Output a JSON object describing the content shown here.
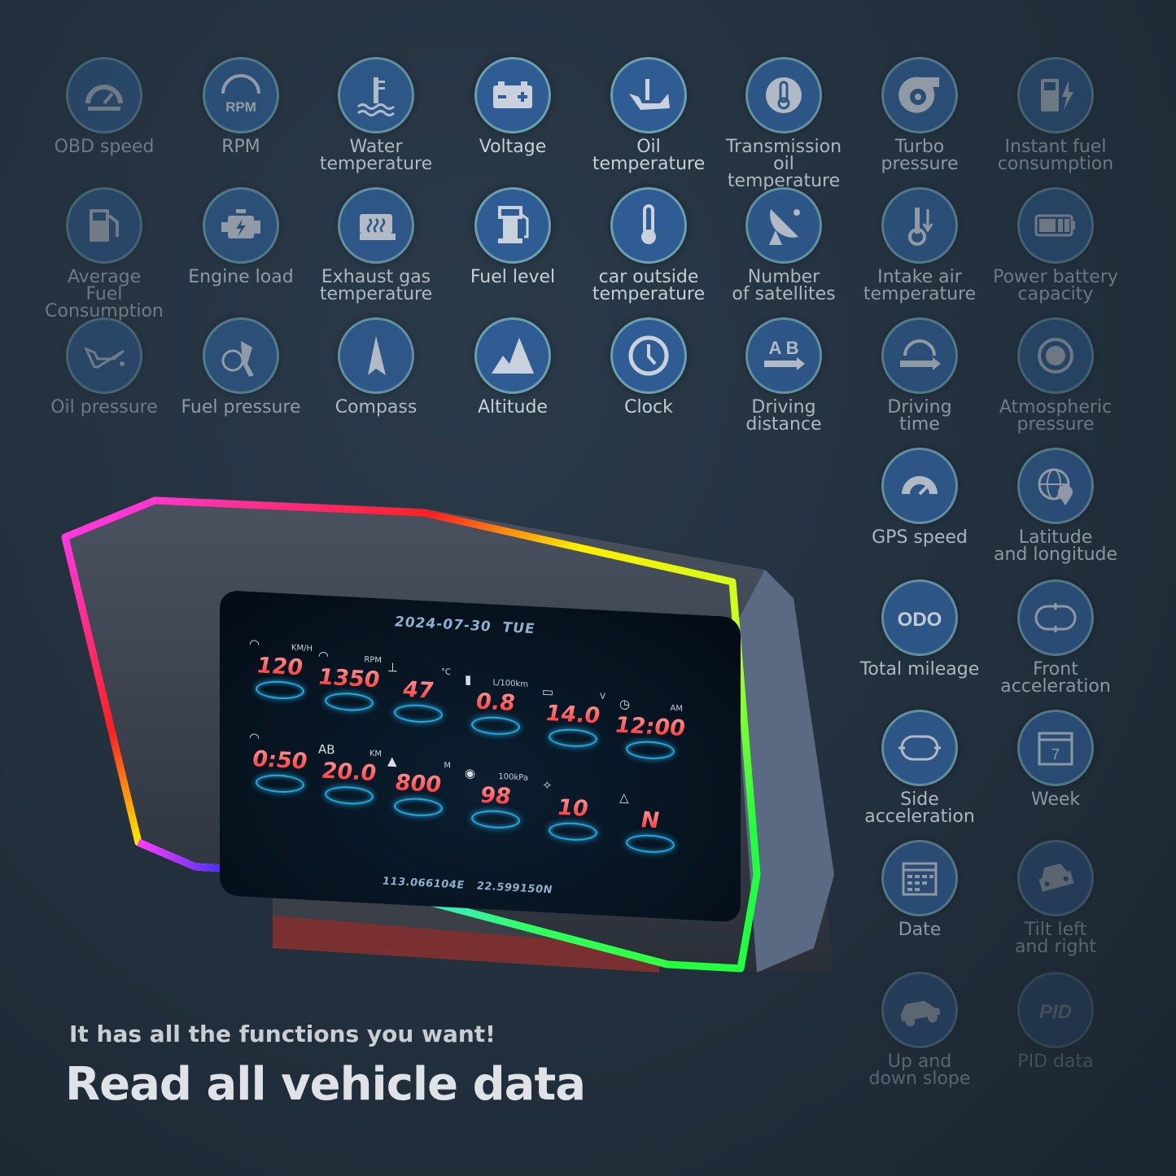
{
  "features": [
    {
      "label": "OBD speed",
      "icon": "speedometer-wrench-icon"
    },
    {
      "label": "RPM",
      "icon": "rpm-gauge-icon"
    },
    {
      "label": "Water\ntemperature",
      "icon": "coolant-temperature-icon"
    },
    {
      "label": "Voltage",
      "icon": "battery-icon"
    },
    {
      "label": "Oil\ntemperature",
      "icon": "oil-can-thermometer-icon"
    },
    {
      "label": "Transmission\noil temperature",
      "icon": "gear-thermometer-icon"
    },
    {
      "label": "Turbo\npressure",
      "icon": "turbocharger-icon"
    },
    {
      "label": "Instant fuel\nconsumption",
      "icon": "fuel-pump-bolt-icon"
    },
    {
      "label": "Average\nFuel Consumption",
      "icon": "fuel-pump-icon"
    },
    {
      "label": "Engine load",
      "icon": "engine-icon"
    },
    {
      "label": "Exhaust gas\ntemperature",
      "icon": "exhaust-heat-icon"
    },
    {
      "label": "Fuel level",
      "icon": "fuel-station-icon"
    },
    {
      "label": "car outside\ntemperature",
      "icon": "thermometer-icon"
    },
    {
      "label": "Number\nof satellites",
      "icon": "satellite-dish-icon"
    },
    {
      "label": "Intake air\ntemperature",
      "icon": "intake-air-thermometer-icon"
    },
    {
      "label": "Power battery\ncapacity",
      "icon": "battery-level-icon"
    },
    {
      "label": "Oil pressure",
      "icon": "oil-can-icon"
    },
    {
      "label": "Fuel pressure",
      "icon": "fuel-nozzle-gauge-icon"
    },
    {
      "label": "Compass",
      "icon": "compass-arrow-icon"
    },
    {
      "label": "Altitude",
      "icon": "mountain-icon"
    },
    {
      "label": "Clock",
      "icon": "clock-icon"
    },
    {
      "label": "Driving\ndistance",
      "icon": "ab-arrow-icon"
    },
    {
      "label": "Driving\ntime",
      "icon": "gauge-arrow-icon"
    },
    {
      "label": "Atmospheric\npressure",
      "icon": "pressure-gauge-icon"
    },
    {
      "label": "GPS speed",
      "icon": "gps-speedometer-icon"
    },
    {
      "label": "Latitude\nand longitude",
      "icon": "globe-pin-icon"
    },
    {
      "label": "Total mileage",
      "icon": "odo-icon"
    },
    {
      "label": "Front\nacceleration",
      "icon": "front-acceleration-icon"
    },
    {
      "label": "Side acceleration",
      "icon": "side-acceleration-icon"
    },
    {
      "label": "Week",
      "icon": "calendar-week-icon"
    },
    {
      "label": "Date",
      "icon": "calendar-date-icon"
    },
    {
      "label": "Tilt left\nand right",
      "icon": "car-front-tilt-icon"
    },
    {
      "label": "Up and\ndown slope",
      "icon": "car-slope-icon"
    },
    {
      "label": "PID data",
      "icon": "pid-icon"
    }
  ],
  "device": {
    "date": "2024-07-30",
    "weekday": "TUE",
    "longitude": "113.066104E",
    "latitude": "22.599150N",
    "readings": [
      {
        "icon": "speedometer-icon",
        "unit": "KM/H",
        "value": "120"
      },
      {
        "icon": "rpm-icon",
        "unit": "RPM",
        "value": "1350"
      },
      {
        "icon": "coolant-icon",
        "unit": "°C",
        "value": "47"
      },
      {
        "icon": "fuel-pump-bolt-icon",
        "unit": "L/100km",
        "value": "0.8"
      },
      {
        "icon": "battery-icon",
        "unit": "V",
        "value": "14.0"
      },
      {
        "icon": "clock-icon",
        "unit": "AM",
        "value": "12:00"
      },
      {
        "icon": "driving-time-icon",
        "unit": "",
        "value": "0:50"
      },
      {
        "icon": "ab-arrow-icon",
        "unit": "KM",
        "value": "20.0"
      },
      {
        "icon": "mountain-icon",
        "unit": "M",
        "value": "800"
      },
      {
        "icon": "turbo-icon",
        "unit": "100kPa",
        "value": "98"
      },
      {
        "icon": "satellite-icon",
        "unit": "",
        "value": "10"
      },
      {
        "icon": "compass-icon",
        "unit": "",
        "value": "N"
      }
    ],
    "colors": {
      "value_red": "#ff3b3b",
      "ring_blue": "#2aa8d8"
    }
  },
  "text": {
    "tagline": "It has all the functions you want!",
    "headline": "Read all vehicle data"
  },
  "colors": {
    "circle_fill": "#2f5d93",
    "circle_border": "#6b9fae",
    "label": "#c5cfd8",
    "background": "#243240"
  }
}
